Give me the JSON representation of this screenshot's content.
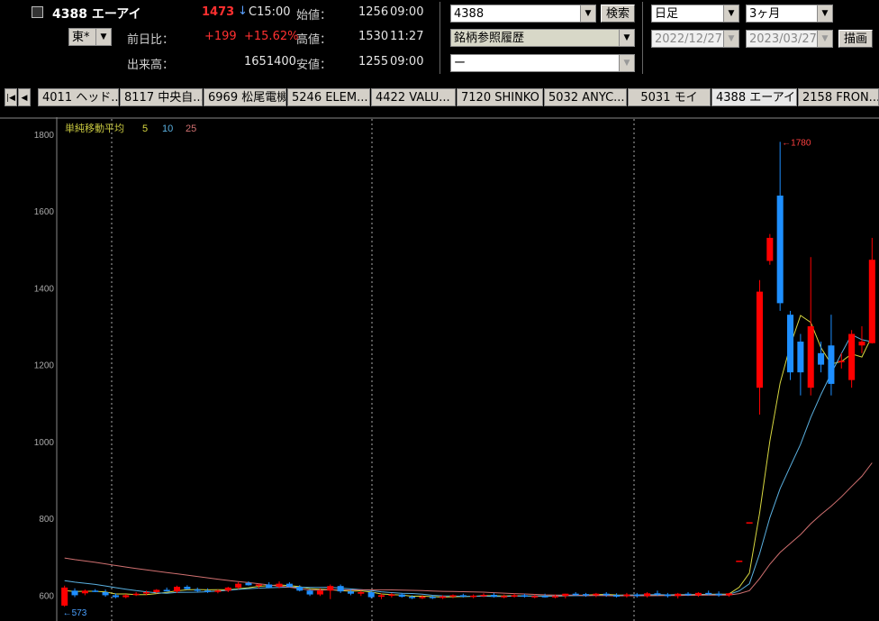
{
  "header": {
    "code_name": "4388 エーアイ",
    "price": "1473",
    "arrow": "↓",
    "close_time": "C15:00",
    "market": "東*",
    "prev_day_label": "前日比：",
    "change": "+199",
    "change_pct": "+15.62%",
    "volume_label": "出来高：",
    "volume": "1651400",
    "open_label": "始値：",
    "open": "1256",
    "open_time": "09:00",
    "high_label": "高値：",
    "high": "1530",
    "high_time": "11:27",
    "low_label": "安値：",
    "low": "1255",
    "low_time": "09:00"
  },
  "search": {
    "code_value": "4388",
    "search_button": "検索",
    "history_value": "銘柄参照履歴",
    "third_value": "ー"
  },
  "period": {
    "type": "日足",
    "span": "3ヶ月",
    "from": "2022/12/27",
    "to": "2023/03/27",
    "draw_button": "描画"
  },
  "tabs": [
    {
      "label": "4011 ヘッド..."
    },
    {
      "label": "8117 中央自..."
    },
    {
      "label": "6969 松尾電機"
    },
    {
      "label": "5246 ELEM..."
    },
    {
      "label": "4422 VALU..."
    },
    {
      "label": "7120 SHINKO"
    },
    {
      "label": "5032 ANYC..."
    },
    {
      "label": "5031 モイ"
    },
    {
      "label": "4388 エーアイ"
    },
    {
      "label": "2158 FRON..."
    }
  ],
  "chart_data": {
    "type": "candlestick",
    "legend": {
      "title": "単純移動平均",
      "periods": [
        "5",
        "10",
        "25"
      ],
      "colors": [
        "#d8d840",
        "#5ab0e0",
        "#d07070"
      ]
    },
    "y_ticks": [
      600,
      800,
      1000,
      1200,
      1400,
      1600,
      1800
    ],
    "ylim": [
      540,
      1830
    ],
    "annotations": {
      "high": "←1780",
      "low": "←573"
    },
    "up_color": "#ff0000",
    "down_color": "#1e8fff",
    "candles": [
      {
        "o": 573,
        "h": 625,
        "l": 570,
        "c": 620
      },
      {
        "o": 612,
        "h": 618,
        "l": 595,
        "c": 600
      },
      {
        "o": 605,
        "h": 615,
        "l": 600,
        "c": 612
      },
      {
        "o": 612,
        "h": 616,
        "l": 608,
        "c": 610
      },
      {
        "o": 608,
        "h": 615,
        "l": 596,
        "c": 600
      },
      {
        "o": 600,
        "h": 605,
        "l": 592,
        "c": 595
      },
      {
        "o": 595,
        "h": 603,
        "l": 592,
        "c": 600
      },
      {
        "o": 602,
        "h": 608,
        "l": 598,
        "c": 604
      },
      {
        "o": 605,
        "h": 612,
        "l": 600,
        "c": 608
      },
      {
        "o": 608,
        "h": 616,
        "l": 605,
        "c": 614
      },
      {
        "o": 614,
        "h": 620,
        "l": 610,
        "c": 610
      },
      {
        "o": 610,
        "h": 625,
        "l": 606,
        "c": 622
      },
      {
        "o": 622,
        "h": 626,
        "l": 614,
        "c": 616
      },
      {
        "o": 615,
        "h": 620,
        "l": 608,
        "c": 612
      },
      {
        "o": 612,
        "h": 618,
        "l": 606,
        "c": 610
      },
      {
        "o": 610,
        "h": 615,
        "l": 605,
        "c": 612
      },
      {
        "o": 612,
        "h": 622,
        "l": 608,
        "c": 620
      },
      {
        "o": 620,
        "h": 634,
        "l": 616,
        "c": 630
      },
      {
        "o": 632,
        "h": 636,
        "l": 625,
        "c": 626
      },
      {
        "o": 625,
        "h": 630,
        "l": 618,
        "c": 628
      },
      {
        "o": 628,
        "h": 634,
        "l": 618,
        "c": 620
      },
      {
        "o": 622,
        "h": 636,
        "l": 618,
        "c": 630
      },
      {
        "o": 630,
        "h": 634,
        "l": 620,
        "c": 622
      },
      {
        "o": 622,
        "h": 626,
        "l": 610,
        "c": 612
      },
      {
        "o": 612,
        "h": 616,
        "l": 598,
        "c": 602
      },
      {
        "o": 602,
        "h": 618,
        "l": 598,
        "c": 612
      },
      {
        "o": 612,
        "h": 628,
        "l": 590,
        "c": 624
      },
      {
        "o": 624,
        "h": 628,
        "l": 606,
        "c": 610
      },
      {
        "o": 610,
        "h": 616,
        "l": 600,
        "c": 604
      },
      {
        "o": 604,
        "h": 612,
        "l": 598,
        "c": 608
      },
      {
        "o": 608,
        "h": 612,
        "l": 592,
        "c": 595
      },
      {
        "o": 596,
        "h": 604,
        "l": 590,
        "c": 600
      },
      {
        "o": 600,
        "h": 606,
        "l": 594,
        "c": 602
      },
      {
        "o": 602,
        "h": 606,
        "l": 594,
        "c": 596
      },
      {
        "o": 596,
        "h": 600,
        "l": 590,
        "c": 594
      },
      {
        "o": 594,
        "h": 600,
        "l": 590,
        "c": 596
      },
      {
        "o": 596,
        "h": 600,
        "l": 590,
        "c": 593
      },
      {
        "o": 593,
        "h": 600,
        "l": 590,
        "c": 597
      },
      {
        "o": 597,
        "h": 602,
        "l": 592,
        "c": 600
      },
      {
        "o": 600,
        "h": 604,
        "l": 594,
        "c": 597
      },
      {
        "o": 597,
        "h": 602,
        "l": 592,
        "c": 599
      },
      {
        "o": 599,
        "h": 605,
        "l": 595,
        "c": 601
      },
      {
        "o": 601,
        "h": 606,
        "l": 594,
        "c": 596
      },
      {
        "o": 596,
        "h": 602,
        "l": 592,
        "c": 598
      },
      {
        "o": 598,
        "h": 604,
        "l": 594,
        "c": 600
      },
      {
        "o": 600,
        "h": 604,
        "l": 594,
        "c": 596
      },
      {
        "o": 596,
        "h": 602,
        "l": 592,
        "c": 598
      },
      {
        "o": 598,
        "h": 604,
        "l": 594,
        "c": 596
      },
      {
        "o": 596,
        "h": 602,
        "l": 592,
        "c": 598
      },
      {
        "o": 598,
        "h": 604,
        "l": 592,
        "c": 604
      },
      {
        "o": 604,
        "h": 608,
        "l": 598,
        "c": 603
      },
      {
        "o": 603,
        "h": 606,
        "l": 596,
        "c": 600
      },
      {
        "o": 600,
        "h": 606,
        "l": 595,
        "c": 604
      },
      {
        "o": 604,
        "h": 608,
        "l": 596,
        "c": 600
      },
      {
        "o": 600,
        "h": 605,
        "l": 594,
        "c": 597
      },
      {
        "o": 598,
        "h": 606,
        "l": 594,
        "c": 602
      },
      {
        "o": 602,
        "h": 606,
        "l": 594,
        "c": 598
      },
      {
        "o": 598,
        "h": 608,
        "l": 594,
        "c": 605
      },
      {
        "o": 605,
        "h": 612,
        "l": 598,
        "c": 602
      },
      {
        "o": 602,
        "h": 606,
        "l": 594,
        "c": 598
      },
      {
        "o": 598,
        "h": 606,
        "l": 592,
        "c": 604
      },
      {
        "o": 604,
        "h": 608,
        "l": 598,
        "c": 600
      },
      {
        "o": 600,
        "h": 608,
        "l": 596,
        "c": 606
      },
      {
        "o": 606,
        "h": 612,
        "l": 600,
        "c": 604
      },
      {
        "o": 604,
        "h": 610,
        "l": 596,
        "c": 600
      },
      {
        "o": 600,
        "h": 606,
        "l": 596,
        "c": 605
      },
      {
        "o": 690,
        "h": 690,
        "l": 690,
        "c": 690
      },
      {
        "o": 790,
        "h": 790,
        "l": 790,
        "c": 790
      },
      {
        "o": 1140,
        "h": 1420,
        "l": 1070,
        "c": 1390
      },
      {
        "o": 1470,
        "h": 1540,
        "l": 1460,
        "c": 1530
      },
      {
        "o": 1640,
        "h": 1780,
        "l": 1340,
        "c": 1360
      },
      {
        "o": 1330,
        "h": 1340,
        "l": 1160,
        "c": 1180
      },
      {
        "o": 1260,
        "h": 1280,
        "l": 1120,
        "c": 1180
      },
      {
        "o": 1140,
        "h": 1480,
        "l": 1120,
        "c": 1300
      },
      {
        "o": 1230,
        "h": 1260,
        "l": 1180,
        "c": 1200
      },
      {
        "o": 1250,
        "h": 1330,
        "l": 1120,
        "c": 1150
      },
      {
        "o": 1210,
        "h": 1230,
        "l": 1190,
        "c": 1210
      },
      {
        "o": 1160,
        "h": 1290,
        "l": 1140,
        "c": 1280
      },
      {
        "o": 1250,
        "h": 1300,
        "l": 1230,
        "c": 1260
      },
      {
        "o": 1256,
        "h": 1530,
        "l": 1255,
        "c": 1473
      }
    ]
  }
}
